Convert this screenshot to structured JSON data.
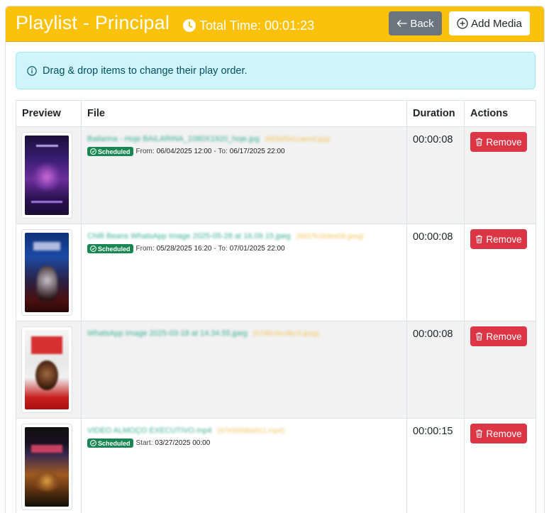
{
  "header": {
    "title": "Playlist - Principal",
    "total_time_label": "Total Time: 00:01:23",
    "back_label": "Back",
    "add_media_label": "Add Media"
  },
  "alert": {
    "text": "Drag & drop items to change their play order."
  },
  "table": {
    "columns": [
      "Preview",
      "File",
      "Duration",
      "Actions"
    ],
    "rows": [
      {
        "file_name": "Bailarina - Hoje BAILARINA_1080X1920_hoje.jpg",
        "file_id": "(683df341caeed.jpg)",
        "badge": "Scheduled",
        "from_label": "From:",
        "from_value": "06/04/2025 12:00",
        "to_label": "- To:",
        "to_value": "06/17/2025 22:00",
        "duration": "00:00:08",
        "remove_label": "Remove"
      },
      {
        "file_name": "Chilli Beans WhatsApp Image 2025-05-28 at 16.09.15.jpeg",
        "file_id": "(6837b1b9ee08.jpeg)",
        "badge": "Scheduled",
        "from_label": "From:",
        "from_value": "05/28/2025 16:20",
        "to_label": "- To:",
        "to_value": "07/01/2025 22:00",
        "duration": "00:00:08",
        "remove_label": "Remove"
      },
      {
        "file_name": "WhatsApp Image 2025-03-18 at 14.34.55.jpeg",
        "file_id": "(67d9c0ec9bc5.jpeg)",
        "duration": "00:00:08",
        "remove_label": "Remove"
      },
      {
        "file_name": "VIDEO ALMOÇO EXECUTIVO.mp4",
        "file_id": "(67e5059be911.mp4)",
        "badge": "Scheduled",
        "start_label": "Start:",
        "start_value": "03/27/2025 00:00",
        "duration": "00:00:15",
        "remove_label": "Remove"
      }
    ]
  },
  "colors": {
    "header_bg": "#fcc10a",
    "back_btn": "#6c757d",
    "alert_bg": "#cff4fc",
    "badge_green": "#198754",
    "remove_red": "#dc3545",
    "file_link": "#37b08b"
  },
  "icons": {
    "clock": "clock-icon",
    "back": "arrow-left-icon",
    "add": "plus-circle-icon",
    "info": "info-circle-icon",
    "check": "check-circle-icon",
    "trash": "trash-icon"
  }
}
